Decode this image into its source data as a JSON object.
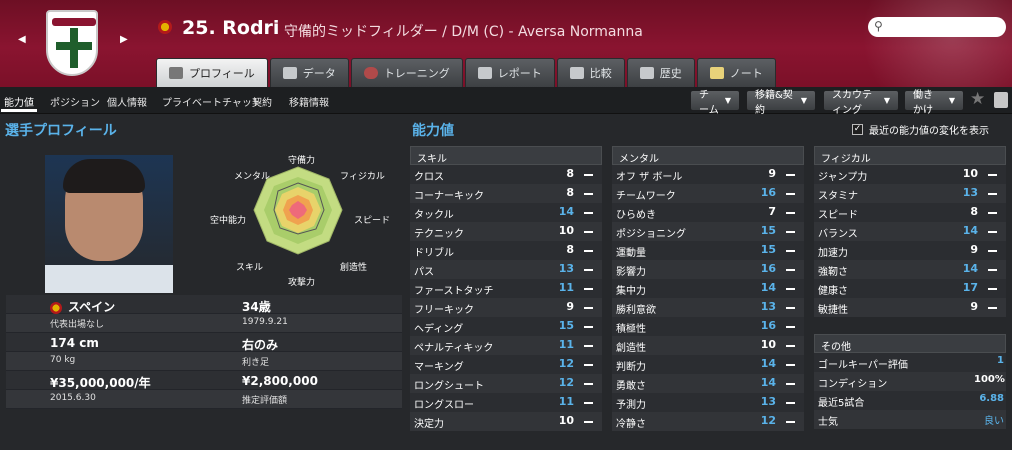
{
  "header": {
    "player_number_name": "25. Rodri",
    "player_subtitle": "守備的ミッドフィルダー / D/M (C) - Aversa Normanna",
    "crest_text": "Aversa Normanna"
  },
  "tabs": [
    {
      "label": "プロフィール",
      "active": true
    },
    {
      "label": "データ"
    },
    {
      "label": "トレーニング"
    },
    {
      "label": "レポート"
    },
    {
      "label": "比較"
    },
    {
      "label": "歴史"
    },
    {
      "label": "ノート"
    }
  ],
  "subnav": [
    "能力値",
    "ポジション",
    "個人情報",
    "プライベートチャット",
    "契約",
    "移籍情報"
  ],
  "dropdowns": [
    "チーム",
    "移籍&契約",
    "スカウティング",
    "働きかけ"
  ],
  "profile_title": "選手プロフィール",
  "ability_title": "能力値",
  "toggle_label": "最近の能力値の変化を表示",
  "radar_labels": [
    "守備力",
    "フィジカル",
    "スピード",
    "創造性",
    "攻撃力",
    "スキル",
    "空中能力",
    "メンタル"
  ],
  "info": {
    "nationality": "スペイン",
    "age": "34歳",
    "caps": "代表出場なし",
    "dob": "1979.9.21",
    "height": "174 cm",
    "foot": "右のみ",
    "weight": "70 kg",
    "foot_label": "利き足",
    "wage": "¥35,000,000/年",
    "value": "¥2,800,000",
    "contract": "2015.6.30",
    "value_label": "推定評価額"
  },
  "skills_header": "スキル",
  "mental_header": "メンタル",
  "physical_header": "フィジカル",
  "other_header": "その他",
  "skills": [
    {
      "n": "クロス",
      "v": "8",
      "c": "w"
    },
    {
      "n": "コーナーキック",
      "v": "8",
      "c": "w"
    },
    {
      "n": "タックル",
      "v": "14",
      "c": "b"
    },
    {
      "n": "テクニック",
      "v": "10",
      "c": "w"
    },
    {
      "n": "ドリブル",
      "v": "8",
      "c": "w"
    },
    {
      "n": "パス",
      "v": "13",
      "c": "b"
    },
    {
      "n": "ファーストタッチ",
      "v": "11",
      "c": "b"
    },
    {
      "n": "フリーキック",
      "v": "9",
      "c": "w"
    },
    {
      "n": "ヘディング",
      "v": "15",
      "c": "b"
    },
    {
      "n": "ペナルティキック",
      "v": "11",
      "c": "b"
    },
    {
      "n": "マーキング",
      "v": "12",
      "c": "b"
    },
    {
      "n": "ロングシュート",
      "v": "12",
      "c": "b"
    },
    {
      "n": "ロングスロー",
      "v": "11",
      "c": "b"
    },
    {
      "n": "決定力",
      "v": "10",
      "c": "w"
    }
  ],
  "mental": [
    {
      "n": "オフ ザ ボール",
      "v": "9",
      "c": "w"
    },
    {
      "n": "チームワーク",
      "v": "16",
      "c": "b"
    },
    {
      "n": "ひらめき",
      "v": "7",
      "c": "w"
    },
    {
      "n": "ポジショニング",
      "v": "15",
      "c": "b"
    },
    {
      "n": "運動量",
      "v": "15",
      "c": "b"
    },
    {
      "n": "影響力",
      "v": "16",
      "c": "b"
    },
    {
      "n": "集中力",
      "v": "14",
      "c": "b"
    },
    {
      "n": "勝利意欲",
      "v": "13",
      "c": "b"
    },
    {
      "n": "積極性",
      "v": "16",
      "c": "b"
    },
    {
      "n": "創造性",
      "v": "10",
      "c": "w"
    },
    {
      "n": "判断力",
      "v": "14",
      "c": "b"
    },
    {
      "n": "勇敢さ",
      "v": "14",
      "c": "b"
    },
    {
      "n": "予測力",
      "v": "13",
      "c": "b"
    },
    {
      "n": "冷静さ",
      "v": "12",
      "c": "b"
    }
  ],
  "physical": [
    {
      "n": "ジャンプ力",
      "v": "10",
      "c": "w"
    },
    {
      "n": "スタミナ",
      "v": "13",
      "c": "b"
    },
    {
      "n": "スピード",
      "v": "8",
      "c": "w"
    },
    {
      "n": "バランス",
      "v": "14",
      "c": "b"
    },
    {
      "n": "加速力",
      "v": "9",
      "c": "w"
    },
    {
      "n": "強靭さ",
      "v": "14",
      "c": "b"
    },
    {
      "n": "健康さ",
      "v": "17",
      "c": "b"
    },
    {
      "n": "敏捷性",
      "v": "9",
      "c": "w"
    }
  ],
  "other": [
    {
      "n": "ゴールキーパー評価",
      "v": "1"
    },
    {
      "n": "コンディション",
      "v": "100%"
    },
    {
      "n": "最近5試合",
      "v": "6.88"
    },
    {
      "n": "士気",
      "v": "良い"
    }
  ]
}
